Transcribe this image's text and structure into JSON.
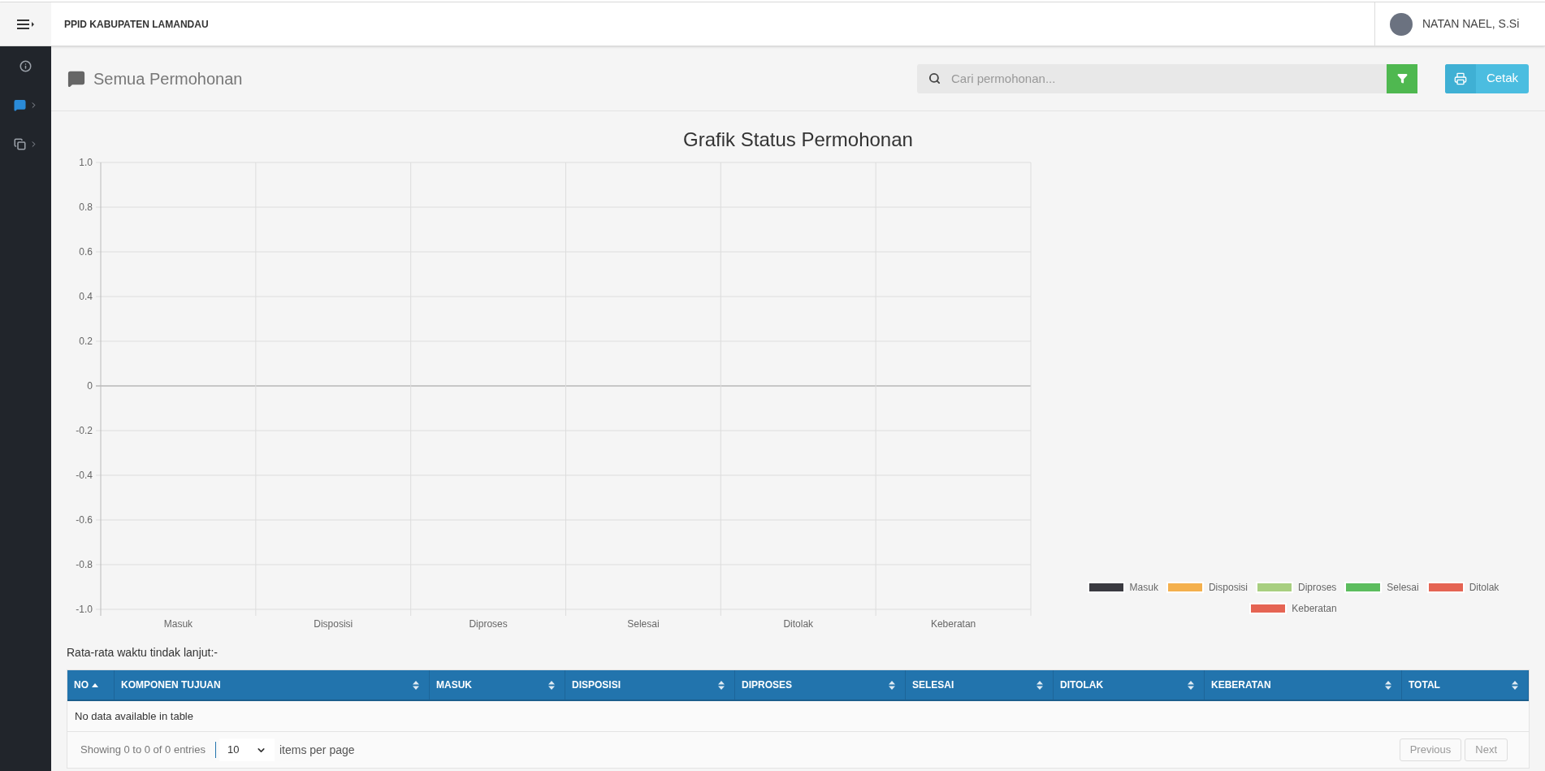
{
  "topbar": {
    "brand": "PPID KABUPATEN LAMANDAU",
    "user": "NATAN NAEL, S.Si"
  },
  "sidebar": {
    "items": [
      {
        "selected": false,
        "has_submenu": false
      },
      {
        "selected": true,
        "has_submenu": true
      },
      {
        "selected": false,
        "has_submenu": true
      }
    ]
  },
  "page": {
    "title": "Semua Permohonan",
    "search": {
      "placeholder": "Cari permohonan..."
    },
    "print_button": "Cetak"
  },
  "chart": {
    "chart_data": {
      "type": "bar",
      "title": "Grafik Status Permohonan",
      "categories": [
        "Masuk",
        "Disposisi",
        "Diproses",
        "Selesai",
        "Ditolak",
        "Keberatan"
      ],
      "series": [
        {
          "name": "Masuk",
          "color": "#3a3a40",
          "values": [
            null,
            null,
            null,
            null,
            null,
            null
          ]
        },
        {
          "name": "Disposisi",
          "color": "#f4b04d",
          "values": [
            null,
            null,
            null,
            null,
            null,
            null
          ]
        },
        {
          "name": "Diproses",
          "color": "#a8cf80",
          "values": [
            null,
            null,
            null,
            null,
            null,
            null
          ]
        },
        {
          "name": "Selesai",
          "color": "#5cbd5e",
          "values": [
            null,
            null,
            null,
            null,
            null,
            null
          ]
        },
        {
          "name": "Ditolak",
          "color": "#e56453",
          "values": [
            null,
            null,
            null,
            null,
            null,
            null
          ]
        },
        {
          "name": "Keberatan",
          "color": "#e56453",
          "values": [
            null,
            null,
            null,
            null,
            null,
            null
          ]
        }
      ],
      "grid": true,
      "ylim": [
        -1,
        1
      ],
      "yticks": [
        {
          "value": 1,
          "label": "1.0"
        },
        {
          "value": 0.8,
          "label": "0.8"
        },
        {
          "value": 0.6,
          "label": "0.6"
        },
        {
          "value": 0.4,
          "label": "0.4"
        },
        {
          "value": 0.2,
          "label": "0.2"
        },
        {
          "value": 0,
          "label": "0"
        },
        {
          "value": -0.2,
          "label": "-0.2"
        },
        {
          "value": -0.4,
          "label": "-0.4"
        },
        {
          "value": -0.6,
          "label": "-0.6"
        },
        {
          "value": -0.8,
          "label": "-0.8"
        },
        {
          "value": -1,
          "label": "-1.0"
        }
      ]
    }
  },
  "summary": "Rata-rata waktu tindak lanjut:-",
  "table": {
    "columns": [
      {
        "label": "NO",
        "sorted_ascending": true
      },
      {
        "label": "KOMPONEN TUJUAN",
        "sorted_ascending": false
      },
      {
        "label": "MASUK",
        "sorted_ascending": false
      },
      {
        "label": "DISPOSISI",
        "sorted_ascending": false
      },
      {
        "label": "DIPROSES",
        "sorted_ascending": false
      },
      {
        "label": "SELESAI",
        "sorted_ascending": false
      },
      {
        "label": "DITOLAK",
        "sorted_ascending": false
      },
      {
        "label": "KEBERATAN",
        "sorted_ascending": false
      },
      {
        "label": "TOTAL",
        "sorted_ascending": false
      }
    ],
    "empty_message": "No data available in table"
  },
  "footer": {
    "info": "Showing 0 to 0 of 0 entries",
    "page_size": "10",
    "page_size_label": "items per page",
    "buttons": [
      {
        "label": "Previous",
        "disabled": true
      },
      {
        "label": "Next",
        "disabled": true
      }
    ]
  }
}
